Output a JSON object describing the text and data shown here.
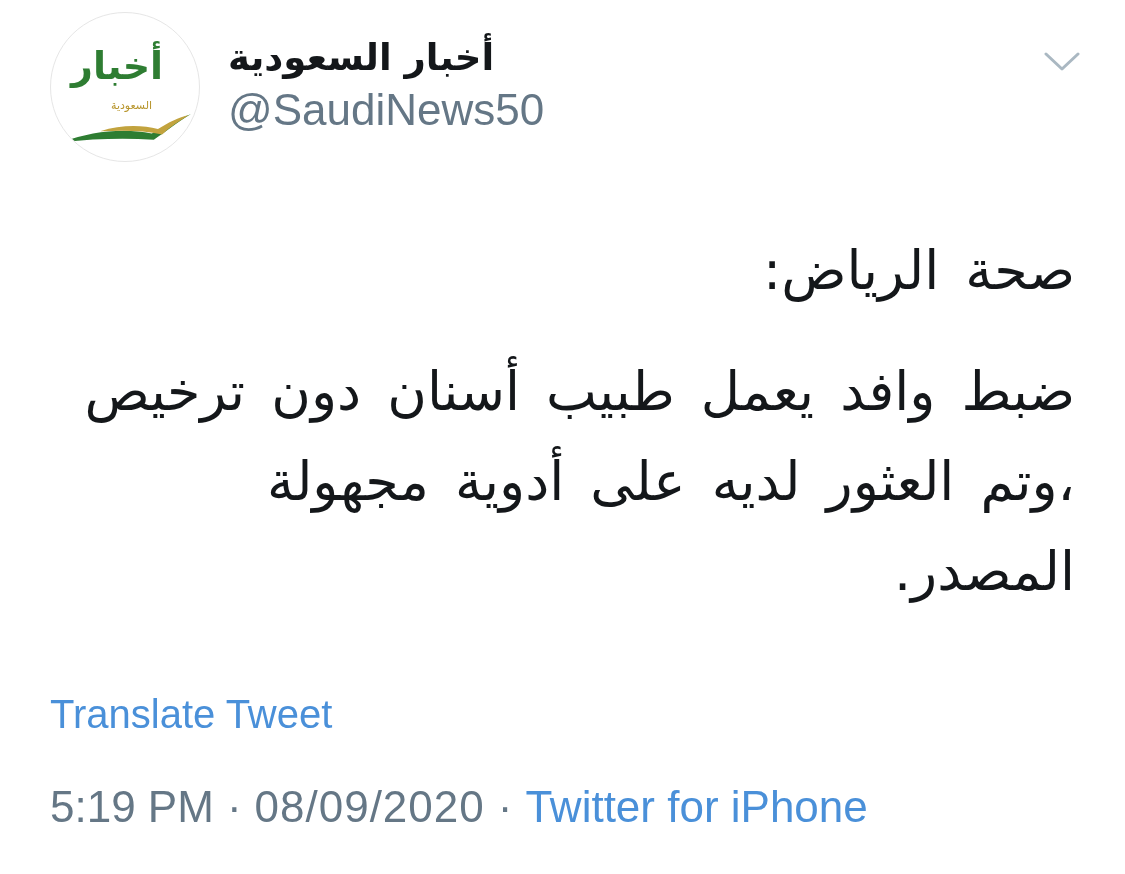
{
  "author": {
    "avatar": {
      "logo_title": "أخبار",
      "logo_subtitle": "السعودية"
    },
    "display_name": "أخبار السعودية",
    "handle": "@SaudiNews50"
  },
  "tweet": {
    "paragraphs": [
      "صحة الرياض:",
      "ضبط وافد يعمل طبيب أسنان دون ترخيص ،وتم العثور لديه على أدوية مجهولة المصدر."
    ]
  },
  "translate_link": "Translate Tweet",
  "footer": {
    "time": "5:19 PM",
    "separator_1": "·",
    "date": "08/09/2020",
    "separator_2": "·",
    "source": "Twitter for iPhone"
  }
}
